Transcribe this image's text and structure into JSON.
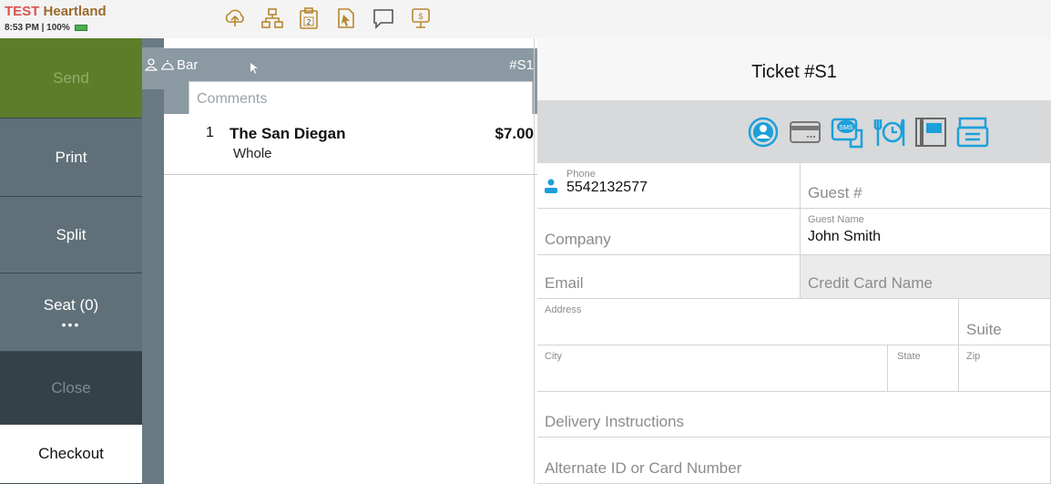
{
  "brand": {
    "test": "TEST",
    "name": "Heartland",
    "time": "8:53 PM",
    "battery": "100%"
  },
  "toolbar": {
    "icons": [
      "cloud-upload-icon",
      "network-icon",
      "clipboard-2-icon",
      "document-cursor-icon",
      "chat-bubble-icon",
      "tip-jar-icon"
    ],
    "clipboard_badge": "2"
  },
  "left_buttons": {
    "send": "Send",
    "print": "Print",
    "split": "Split",
    "seat": "Seat (0)",
    "seat_more": "•••",
    "close": "Close",
    "checkout": "Checkout"
  },
  "order": {
    "location": "Bar",
    "ticket_number": "#S1",
    "comments_placeholder": "Comments",
    "items": [
      {
        "qty": "1",
        "name": "The San Diegan",
        "modifier": "Whole",
        "price": "$7.00"
      }
    ]
  },
  "ticket": {
    "title": "Ticket #S1",
    "action_icons": [
      "loyalty-icon",
      "credit-card-icon",
      "sms-icon",
      "dining-clock-icon",
      "menu-book-icon",
      "receipt-printer-icon"
    ],
    "form": {
      "phone_label": "Phone",
      "phone_value": "5542132577",
      "guest_num_placeholder": "Guest #",
      "company_placeholder": "Company",
      "guest_name_label": "Guest Name",
      "guest_name_value": "John Smith",
      "email_placeholder": "Email",
      "cc_name_placeholder": "Credit Card Name",
      "address_label": "Address",
      "suite_placeholder": "Suite",
      "city_label": "City",
      "state_label": "State",
      "zip_label": "Zip",
      "delivery_placeholder": "Delivery Instructions",
      "alt_id_placeholder": "Alternate ID or Card Number"
    }
  },
  "colors": {
    "send_bg": "#5c7e2a",
    "button_bg": "#607079",
    "close_bg": "#334249",
    "accent_blue": "#1ca0d9",
    "toolbar_gold": "#b8862e"
  }
}
